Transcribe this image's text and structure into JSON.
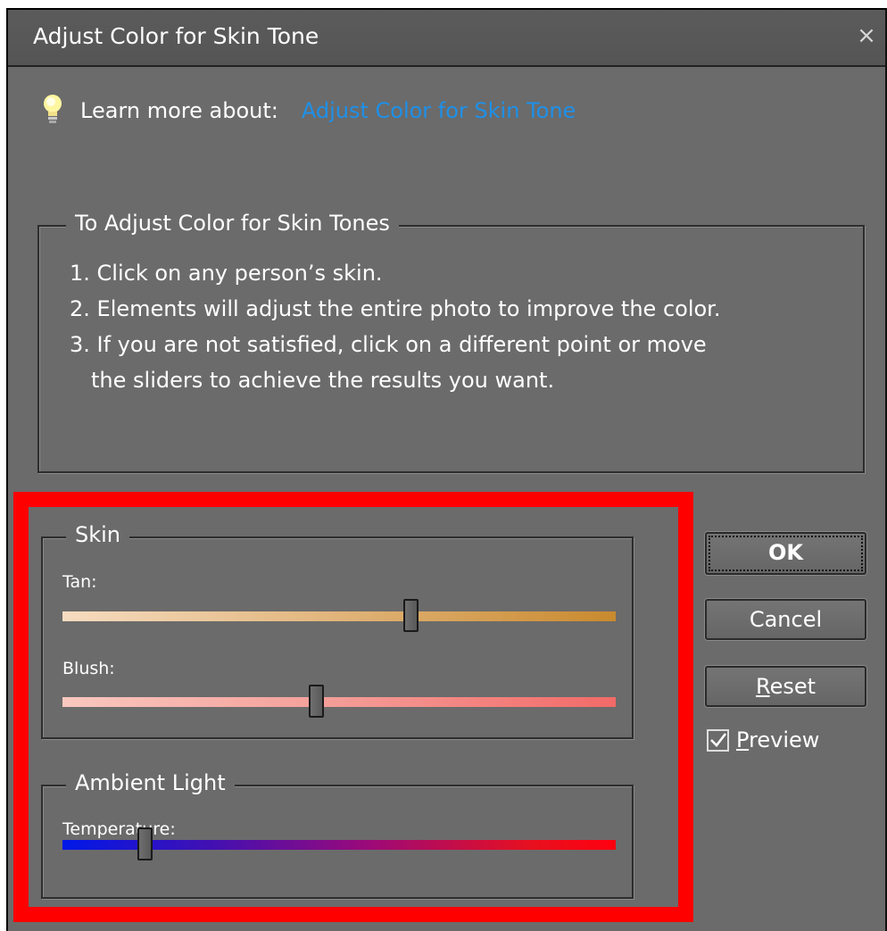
{
  "dialog": {
    "title": "Adjust Color for Skin Tone",
    "close_glyph": "×"
  },
  "learn_more": {
    "label": "Learn more about:",
    "link_text": "Adjust Color for Skin Tone",
    "link_color": "#1e90e8"
  },
  "instructions": {
    "title": "To Adjust Color for Skin Tones",
    "steps": [
      "1. Click on any person’s skin.",
      "2. Elements will adjust the entire photo to improve the color.",
      "3. If you are not satisfied, click on a different point or move",
      "the sliders to achieve the results you want."
    ]
  },
  "skin": {
    "title": "Skin",
    "tan": {
      "label": "Tan:",
      "value": 0.63
    },
    "blush": {
      "label": "Blush:",
      "value": 0.46
    }
  },
  "ambient": {
    "title": "Ambient Light",
    "temperature": {
      "label": "Temperature:",
      "value": 0.15
    }
  },
  "buttons": {
    "ok": "OK",
    "cancel": "Cancel",
    "reset_underline": "R",
    "reset_rest": "eset"
  },
  "preview": {
    "underline": "P",
    "rest": "review",
    "checked": true
  },
  "colors": {
    "highlight_box": "#ff0000",
    "dialog_bg": "#6b6b6b"
  }
}
